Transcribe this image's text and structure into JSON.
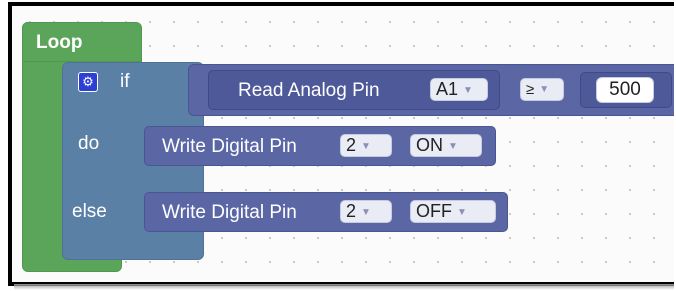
{
  "loop": {
    "label": "Loop"
  },
  "if_block": {
    "if_label": "if",
    "do_label": "do",
    "else_label": "else",
    "gear_icon": "gear-icon"
  },
  "condition": {
    "read_label": "Read Analog Pin",
    "pin_value": "A1",
    "operator": "≥",
    "threshold": "500"
  },
  "do_action": {
    "label": "Write Digital Pin",
    "pin": "2",
    "state": "ON"
  },
  "else_action": {
    "label": "Write Digital Pin",
    "pin": "2",
    "state": "OFF"
  },
  "colors": {
    "loop": "#5ba55b",
    "if_block": "#5b80a5",
    "io_block": "#5b67a5"
  }
}
